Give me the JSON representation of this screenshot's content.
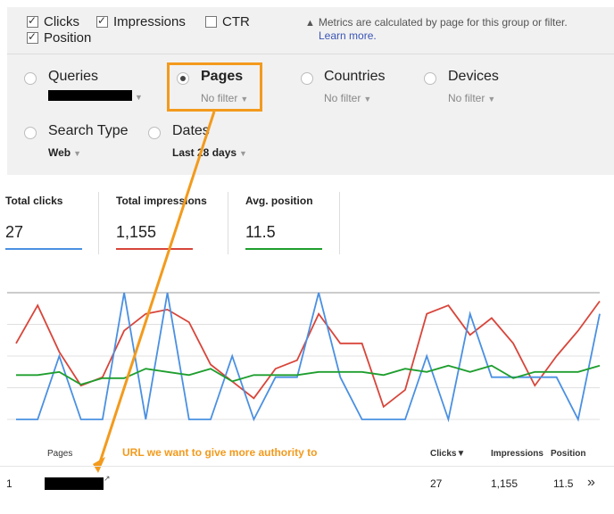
{
  "metrics": {
    "clicks": {
      "label": "Clicks",
      "checked": true
    },
    "impressions": {
      "label": "Impressions",
      "checked": true
    },
    "ctr": {
      "label": "CTR",
      "checked": false
    },
    "position": {
      "label": "Position",
      "checked": true
    }
  },
  "note": {
    "icon": "warning-icon",
    "text": "Metrics are calculated by page for this group or filter.",
    "link": "Learn more."
  },
  "dimensions": {
    "queries": {
      "label": "Queries"
    },
    "pages": {
      "label": "Pages",
      "selected": true,
      "filter": "No filter"
    },
    "countries": {
      "label": "Countries",
      "filter": "No filter"
    },
    "devices": {
      "label": "Devices",
      "filter": "No filter"
    },
    "search_type": {
      "label": "Search Type",
      "value": "Web"
    },
    "dates": {
      "label": "Dates",
      "value": "Last 28 days"
    }
  },
  "totals": {
    "clicks": {
      "label": "Total clicks",
      "value": "27",
      "color": "#4a90e2"
    },
    "impressions": {
      "label": "Total impressions",
      "value": "1,155",
      "color": "#d8453a"
    },
    "position": {
      "label": "Avg. position",
      "value": "11.5",
      "color": "#1e9e2e"
    }
  },
  "chart_data": {
    "type": "line",
    "x": [
      1,
      2,
      3,
      4,
      5,
      6,
      7,
      8,
      9,
      10,
      11,
      12,
      13,
      14,
      15,
      16,
      17,
      18,
      19,
      20,
      21,
      22,
      23,
      24,
      25,
      26,
      27,
      28
    ],
    "series": [
      {
        "color": "#d8453a",
        "values": [
          48,
          57,
          46,
          38,
          40,
          51,
          55,
          56,
          53,
          43,
          39,
          35,
          42,
          44,
          55,
          48,
          48,
          33,
          37,
          55,
          57,
          50,
          54,
          48,
          38,
          45,
          51,
          58
        ]
      },
      {
        "color": "#4a90e2",
        "values": [
          0,
          0,
          3,
          0,
          0,
          6,
          0,
          6,
          0,
          0,
          3,
          0,
          2,
          2,
          6,
          2,
          0,
          0,
          0,
          3,
          0,
          5,
          2,
          2,
          2,
          2,
          0,
          5
        ]
      },
      {
        "color": "#1e9e2e",
        "values": [
          14,
          14,
          15,
          11,
          13,
          13,
          16,
          15,
          14,
          16,
          12,
          14,
          14,
          14,
          15,
          15,
          15,
          14,
          16,
          15,
          17,
          15,
          17,
          13,
          15,
          15,
          15,
          17
        ]
      }
    ]
  },
  "annotation": "URL we want to give more authority to",
  "table": {
    "headers": {
      "pages": "Pages",
      "clicks": "Clicks",
      "sort_indicator": "▼",
      "impressions": "Impressions",
      "position": "Position"
    },
    "rows": [
      {
        "index": "1",
        "clicks": "27",
        "impressions": "1,155",
        "position": "11.5",
        "more": "»"
      }
    ]
  }
}
